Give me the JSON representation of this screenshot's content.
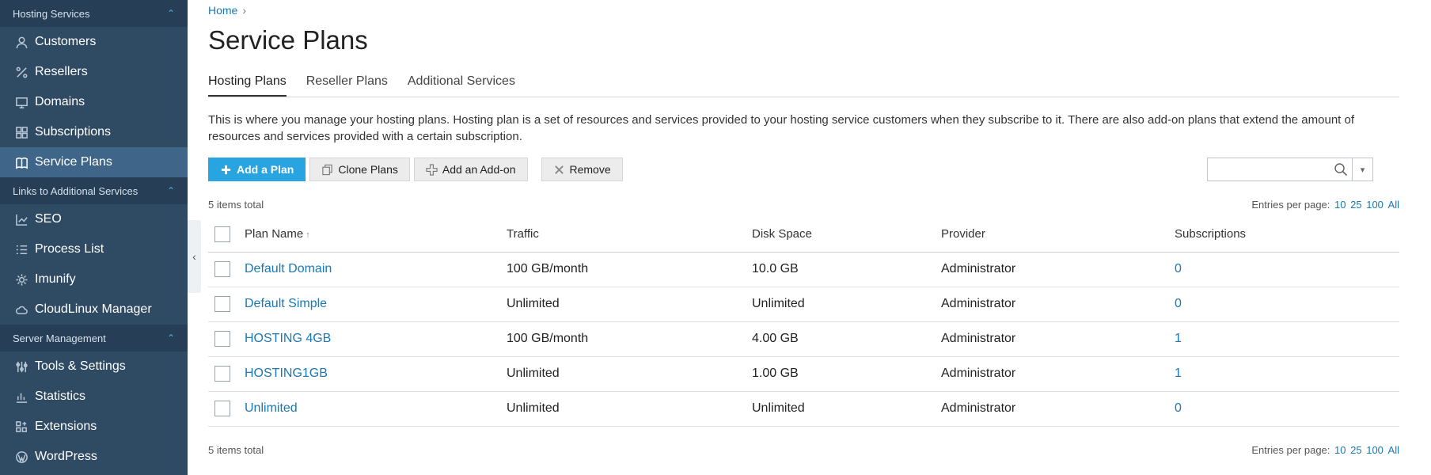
{
  "sidebar": {
    "sections": [
      {
        "title": "Hosting Services",
        "items": [
          {
            "label": "Customers",
            "icon": "user-icon"
          },
          {
            "label": "Resellers",
            "icon": "percent-icon"
          },
          {
            "label": "Domains",
            "icon": "monitor-icon"
          },
          {
            "label": "Subscriptions",
            "icon": "grid-icon"
          },
          {
            "label": "Service Plans",
            "icon": "book-icon",
            "active": true
          }
        ]
      },
      {
        "title": "Links to Additional Services",
        "items": [
          {
            "label": "SEO",
            "icon": "chart-line-icon"
          },
          {
            "label": "Process List",
            "icon": "list-icon"
          },
          {
            "label": "Imunify",
            "icon": "gear-icon"
          },
          {
            "label": "CloudLinux Manager",
            "icon": "cloud-icon"
          }
        ]
      },
      {
        "title": "Server Management",
        "items": [
          {
            "label": "Tools & Settings",
            "icon": "sliders-icon"
          },
          {
            "label": "Statistics",
            "icon": "bar-chart-icon"
          },
          {
            "label": "Extensions",
            "icon": "blocks-icon"
          },
          {
            "label": "WordPress",
            "icon": "wordpress-icon"
          }
        ]
      }
    ]
  },
  "breadcrumb": {
    "home": "Home"
  },
  "page_title": "Service Plans",
  "tabs": [
    {
      "label": "Hosting Plans",
      "active": true
    },
    {
      "label": "Reseller Plans"
    },
    {
      "label": "Additional Services"
    }
  ],
  "description": "This is where you manage your hosting plans. Hosting plan is a set of resources and services provided to your hosting service customers when they subscribe to it. There are also add-on plans that extend the amount of resources and services provided with a certain subscription.",
  "toolbar": {
    "add_plan": "Add a Plan",
    "clone_plans": "Clone Plans",
    "add_addon": "Add an Add-on",
    "remove": "Remove"
  },
  "search": {
    "value": ""
  },
  "list": {
    "total": "5 items total",
    "entries_label": "Entries per page:",
    "entries_options": [
      "10",
      "25",
      "100",
      "All"
    ],
    "columns": [
      "Plan Name",
      "Traffic",
      "Disk Space",
      "Provider",
      "Subscriptions"
    ],
    "rows": [
      {
        "name": "Default Domain",
        "traffic": "100 GB/month",
        "disk": "10.0 GB",
        "provider": "Administrator",
        "subs": "0"
      },
      {
        "name": "Default Simple",
        "traffic": "Unlimited",
        "disk": "Unlimited",
        "provider": "Administrator",
        "subs": "0"
      },
      {
        "name": "HOSTING 4GB",
        "traffic": "100 GB/month",
        "disk": "4.00 GB",
        "provider": "Administrator",
        "subs": "1"
      },
      {
        "name": "HOSTING1GB",
        "traffic": "Unlimited",
        "disk": "1.00 GB",
        "provider": "Administrator",
        "subs": "1"
      },
      {
        "name": "Unlimited",
        "traffic": "Unlimited",
        "disk": "Unlimited",
        "provider": "Administrator",
        "subs": "0"
      }
    ]
  },
  "colors": {
    "sidebar_bg": "#2f4a63",
    "sidebar_header": "#263f56",
    "active_item": "#3f6589",
    "primary": "#28a4e0",
    "link": "#1a78b4"
  }
}
